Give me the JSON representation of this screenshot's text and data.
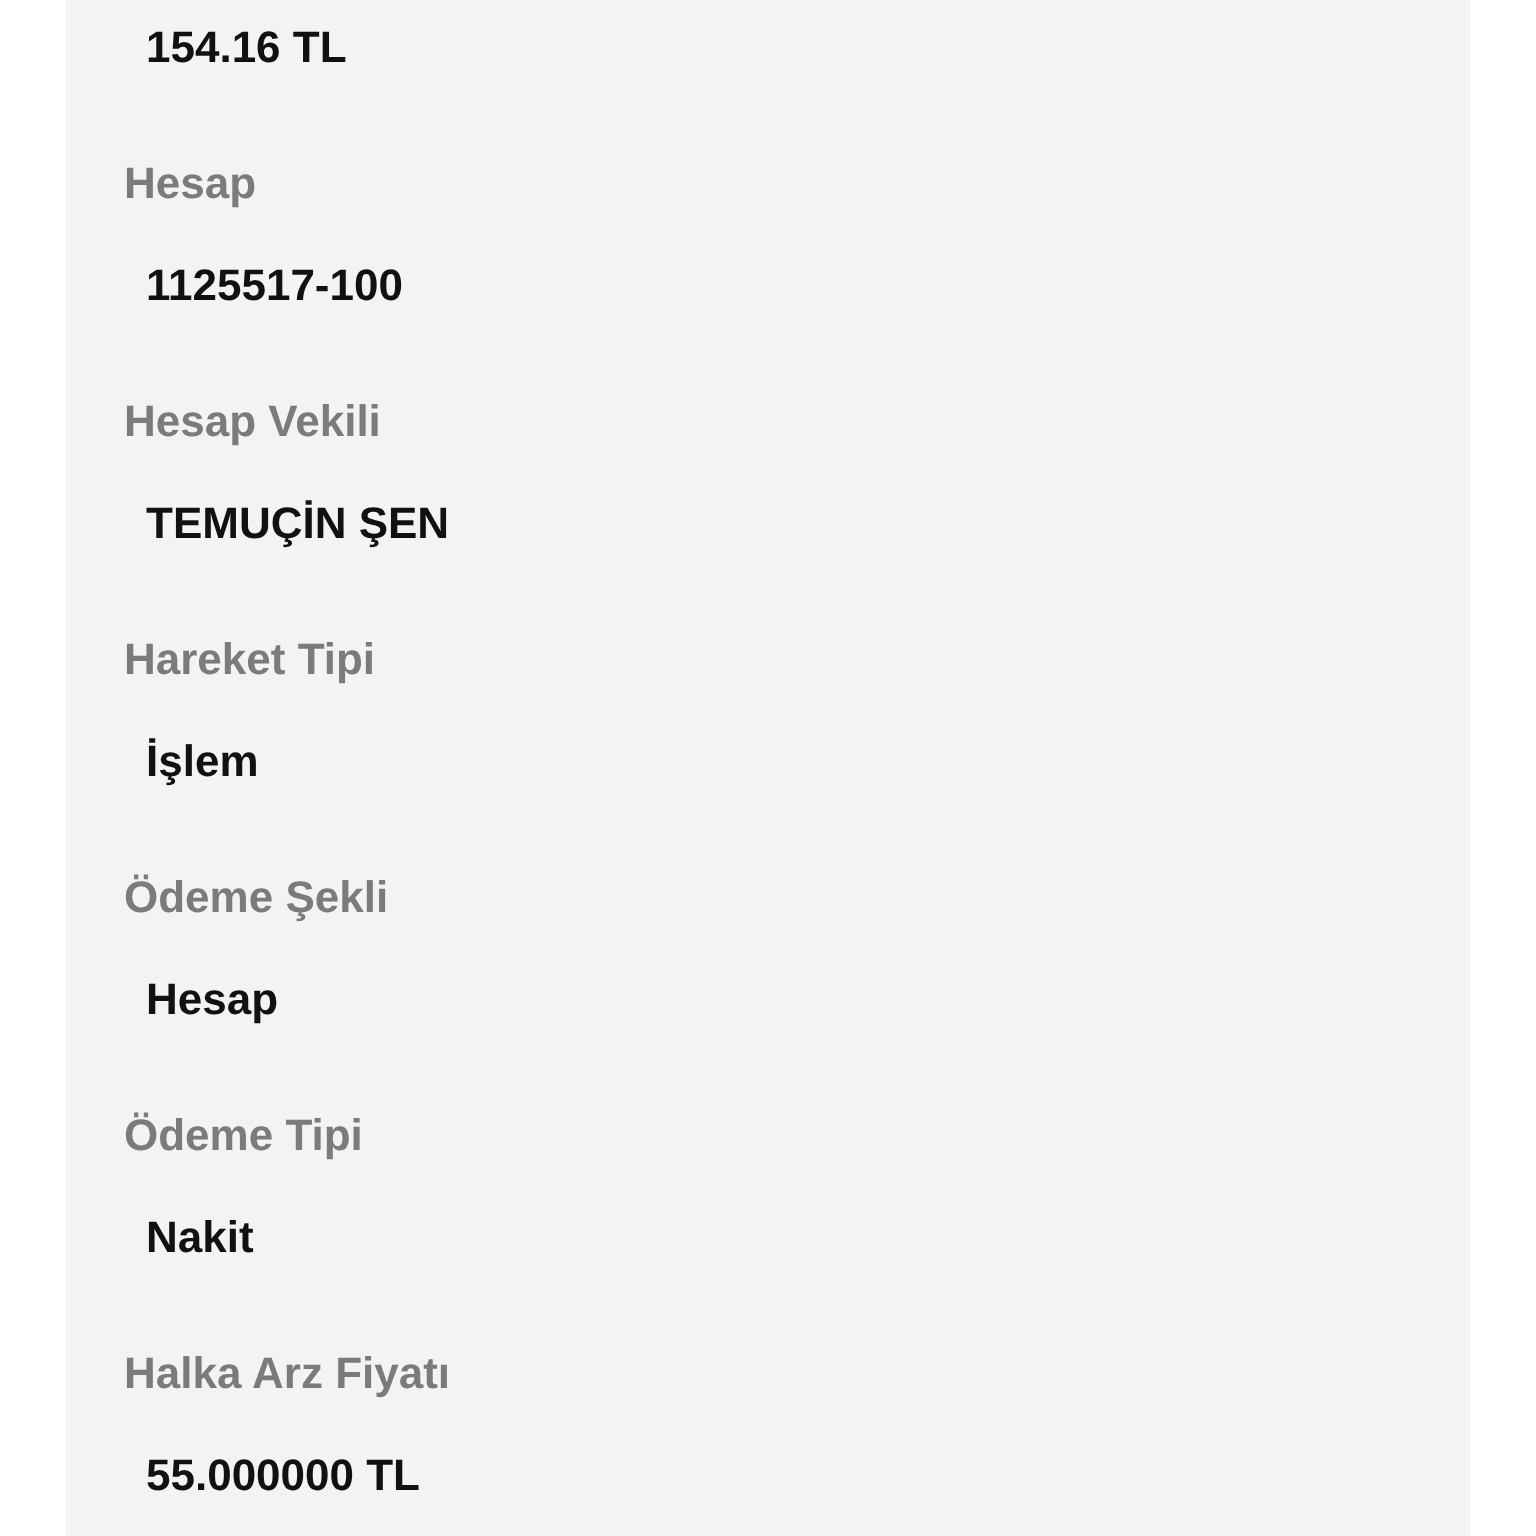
{
  "fields": [
    {
      "value": "154.16 TL"
    },
    {
      "label": "Hesap",
      "value": "1125517-100"
    },
    {
      "label": "Hesap Vekili",
      "value": "TEMUÇİN ŞEN"
    },
    {
      "label": "Hareket Tipi",
      "value": "İşlem"
    },
    {
      "label": "Ödeme Şekli",
      "value": "Hesap"
    },
    {
      "label": "Ödeme Tipi",
      "value": "Nakit"
    },
    {
      "label": "Halka Arz Fiyatı",
      "value": "55.000000 TL"
    }
  ]
}
